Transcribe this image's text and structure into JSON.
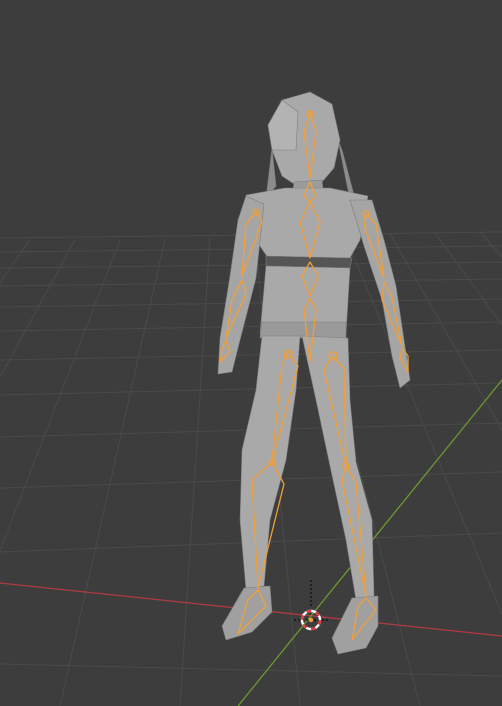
{
  "viewport": {
    "background_color": "#3d3d3d",
    "grid_line_color": "#4a4a4a",
    "x_axis_color": "#b03a44",
    "y_axis_color": "#6a9a2c"
  },
  "character": {
    "mesh_color": "#a9a9a9",
    "mesh_shadow_color": "#8c8c8c",
    "armature_color": "#f29f38"
  },
  "cursor": {
    "ring_colors": [
      "#e0393e",
      "#ffffff"
    ],
    "icon": "3d-cursor-icon"
  }
}
